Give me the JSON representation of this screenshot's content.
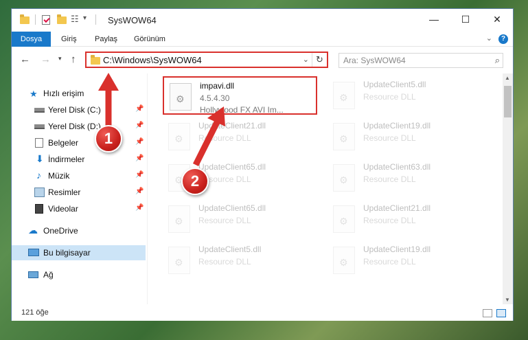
{
  "window": {
    "title": "SysWOW64",
    "min_icon": "minimize-icon",
    "max_icon": "maximize-icon",
    "close_icon": "close-icon"
  },
  "ribbon": {
    "tabs": [
      "Dosya",
      "Giriş",
      "Paylaş",
      "Görünüm"
    ],
    "help": "?"
  },
  "address": {
    "path": "C:\\Windows\\SysWOW64",
    "search_placeholder": "Ara: SysWOW64"
  },
  "nav": {
    "quick_access": "Hızlı erişim",
    "items": [
      {
        "label": "Yerel Disk (C:)",
        "icon": "drive-icon",
        "pinned": true
      },
      {
        "label": "Yerel Disk (D:)",
        "icon": "drive-icon",
        "pinned": true
      },
      {
        "label": "Belgeler",
        "icon": "documents-icon",
        "pinned": true
      },
      {
        "label": "İndirmeler",
        "icon": "downloads-icon",
        "pinned": true
      },
      {
        "label": "Müzik",
        "icon": "music-icon",
        "pinned": true
      },
      {
        "label": "Resimler",
        "icon": "pictures-icon",
        "pinned": true
      },
      {
        "label": "Videolar",
        "icon": "videos-icon",
        "pinned": true
      }
    ],
    "onedrive": "OneDrive",
    "this_pc": "Bu bilgisayar",
    "network": "Ağ"
  },
  "files": [
    {
      "name": "impavi.dll",
      "line2": "4.5.4.30",
      "line3": "Hollywood FX AVI Im...",
      "highlighted": true
    },
    {
      "name": "UpdateClient5.dll",
      "line2": "Resource DLL",
      "line3": ""
    },
    {
      "name": "UpdateClient21.dll",
      "line2": "Resource DLL",
      "line3": ""
    },
    {
      "name": "UpdateClient19.dll",
      "line2": "Resource DLL",
      "line3": ""
    },
    {
      "name": "UpdateClient65.dll",
      "line2": "Resource DLL",
      "line3": ""
    },
    {
      "name": "UpdateClient63.dll",
      "line2": "Resource DLL",
      "line3": ""
    },
    {
      "name": "UpdateClient65.dll",
      "line2": "Resource DLL",
      "line3": ""
    },
    {
      "name": "UpdateClient21.dll",
      "line2": "Resource DLL",
      "line3": ""
    },
    {
      "name": "UpdateClient5.dll",
      "line2": "Resource DLL",
      "line3": ""
    },
    {
      "name": "UpdateClient19.dll",
      "line2": "Resource DLL",
      "line3": ""
    }
  ],
  "status": {
    "count": "121 öğe"
  },
  "annotations": {
    "marker1": "1",
    "marker2": "2",
    "color": "#d9302c"
  }
}
